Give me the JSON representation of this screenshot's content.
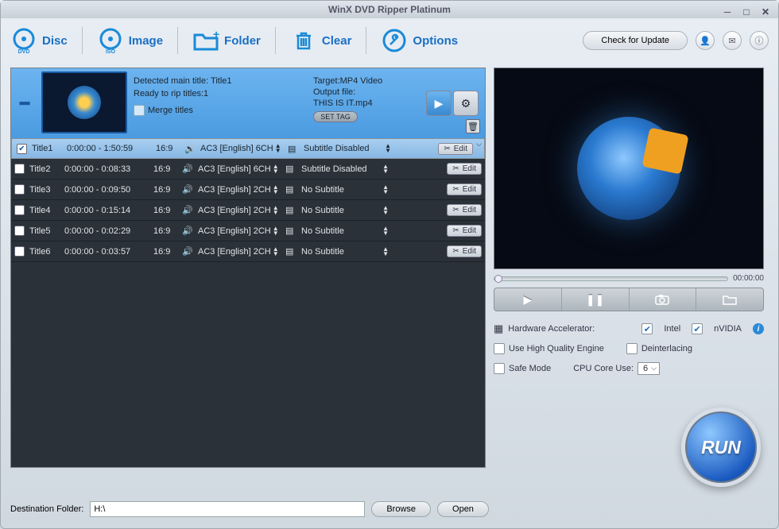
{
  "app_title": "WinX DVD Ripper Platinum",
  "toolbar": {
    "disc": "Disc",
    "image": "Image",
    "folder": "Folder",
    "clear": "Clear",
    "options": "Options",
    "update": "Check for Update"
  },
  "card": {
    "detected": "Detected main title: Title1",
    "ready": "Ready to rip titles:1",
    "merge": "Merge titles",
    "target": "Target:MP4 Video",
    "outfile_label": "Output file:",
    "outfile": "THIS IS IT.mp4",
    "settag": "SET TAG"
  },
  "titles": [
    {
      "checked": true,
      "name": "Title1",
      "time": "0:00:00 - 1:50:59",
      "ratio": "16:9",
      "audio": "AC3  [English]  6CH",
      "sub": "Subtitle Disabled"
    },
    {
      "checked": false,
      "name": "Title2",
      "time": "0:00:00 - 0:08:33",
      "ratio": "16:9",
      "audio": "AC3  [English]  6CH",
      "sub": "Subtitle Disabled"
    },
    {
      "checked": false,
      "name": "Title3",
      "time": "0:00:00 - 0:09:50",
      "ratio": "16:9",
      "audio": "AC3  [English]  2CH",
      "sub": "No Subtitle"
    },
    {
      "checked": false,
      "name": "Title4",
      "time": "0:00:00 - 0:15:14",
      "ratio": "16:9",
      "audio": "AC3  [English]  2CH",
      "sub": "No Subtitle"
    },
    {
      "checked": false,
      "name": "Title5",
      "time": "0:00:00 - 0:02:29",
      "ratio": "16:9",
      "audio": "AC3  [English]  2CH",
      "sub": "No Subtitle"
    },
    {
      "checked": false,
      "name": "Title6",
      "time": "0:00:00 - 0:03:57",
      "ratio": "16:9",
      "audio": "AC3  [English]  2CH",
      "sub": "No Subtitle"
    }
  ],
  "edit_label": "Edit",
  "player": {
    "time": "00:00:00"
  },
  "opts": {
    "hwaccel": "Hardware Accelerator:",
    "intel": "Intel",
    "nvidia": "nVIDIA",
    "hq": "Use High Quality Engine",
    "deint": "Deinterlacing",
    "safe": "Safe Mode",
    "cpu_label": "CPU Core Use:",
    "cpu_val": "6"
  },
  "run": "RUN",
  "dest": {
    "label": "Destination Folder:",
    "value": "H:\\",
    "browse": "Browse",
    "open": "Open"
  }
}
